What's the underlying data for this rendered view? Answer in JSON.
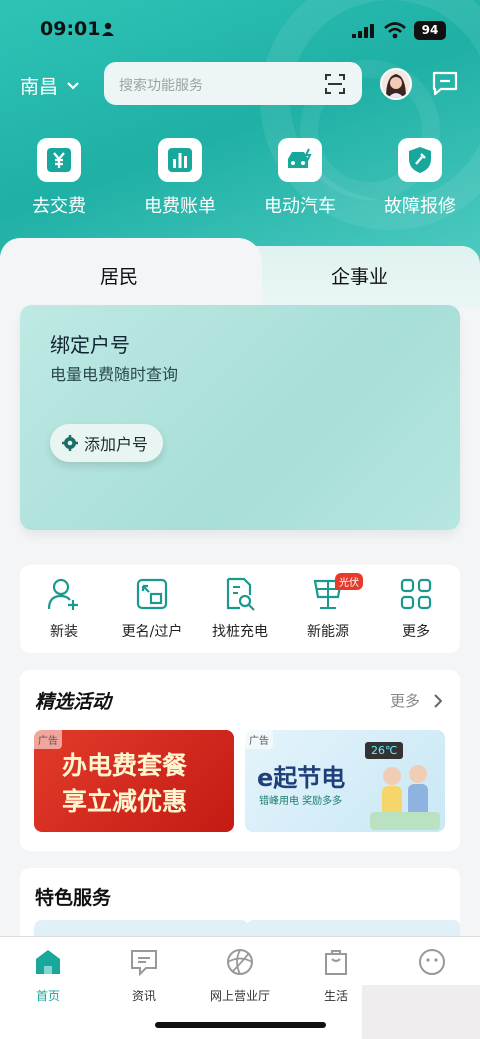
{
  "status": {
    "time": "09:01",
    "battery": "94"
  },
  "header": {
    "city": "南昌",
    "search_placeholder": "搜索功能服务"
  },
  "quick_actions": [
    {
      "label": "去交费",
      "icon": "yen-icon"
    },
    {
      "label": "电费账单",
      "icon": "bar-chart-icon"
    },
    {
      "label": "电动汽车",
      "icon": "ev-car-icon"
    },
    {
      "label": "故障报修",
      "icon": "shield-wrench-icon"
    }
  ],
  "tabs": {
    "resident": "居民",
    "enterprise": "企事业"
  },
  "bind_card": {
    "title": "绑定户号",
    "subtitle": "电量电费随时查询",
    "button": "添加户号"
  },
  "services": [
    {
      "label": "新装",
      "icon": "user-add-icon"
    },
    {
      "label": "更名/过户",
      "icon": "transfer-icon"
    },
    {
      "label": "找桩充电",
      "icon": "search-doc-icon"
    },
    {
      "label": "新能源",
      "icon": "solar-panel-icon",
      "badge": "光伏"
    },
    {
      "label": "更多",
      "icon": "grid-icon"
    }
  ],
  "activities": {
    "title": "精选活动",
    "more": "更多",
    "banner1": {
      "tag": "广告",
      "line1": "办电费套餐",
      "line2": "享立减优惠"
    },
    "banner2": {
      "tag": "广告",
      "title": "e起节电",
      "subtitle": "错峰用电 奖励多多",
      "temp": "26℃"
    }
  },
  "featured": {
    "title": "特色服务"
  },
  "tabbar": [
    {
      "label": "首页",
      "icon": "home-icon",
      "active": true
    },
    {
      "label": "资讯",
      "icon": "chat-icon"
    },
    {
      "label": "网上营业厅",
      "icon": "globe-icon"
    },
    {
      "label": "生活",
      "icon": "bag-icon"
    },
    {
      "label": "",
      "icon": "smile-icon"
    }
  ],
  "colors": {
    "accent": "#1aa79c",
    "hero": "#2fc3b6",
    "badge": "#e83a2a"
  }
}
